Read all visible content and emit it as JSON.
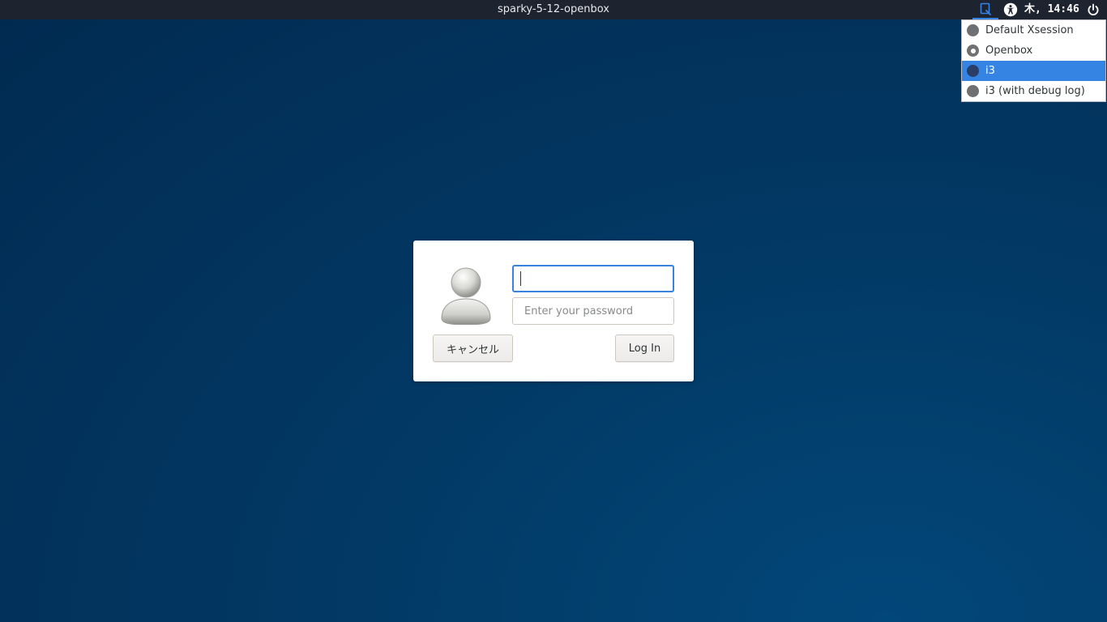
{
  "topbar": {
    "hostname": "sparky-5-12-openbox",
    "session_icon": "session-select-icon",
    "accessibility_icon": "accessibility-icon",
    "clock": "木, 14:46",
    "power_icon": "power-icon"
  },
  "session_menu": {
    "items": [
      {
        "label": "Default Xsession",
        "checked": false,
        "highlighted": false
      },
      {
        "label": "Openbox",
        "checked": true,
        "highlighted": false
      },
      {
        "label": "i3",
        "checked": false,
        "highlighted": true
      },
      {
        "label": "i3 (with debug log)",
        "checked": false,
        "highlighted": false
      }
    ]
  },
  "login": {
    "avatar_icon": "user-avatar-icon",
    "username_value": "",
    "password_placeholder": "Enter your password",
    "cancel_label": "キャンセル",
    "login_label": "Log In"
  },
  "colors": {
    "accent": "#3584e4",
    "topbar_bg": "#1e2330",
    "background": "#023a66"
  }
}
